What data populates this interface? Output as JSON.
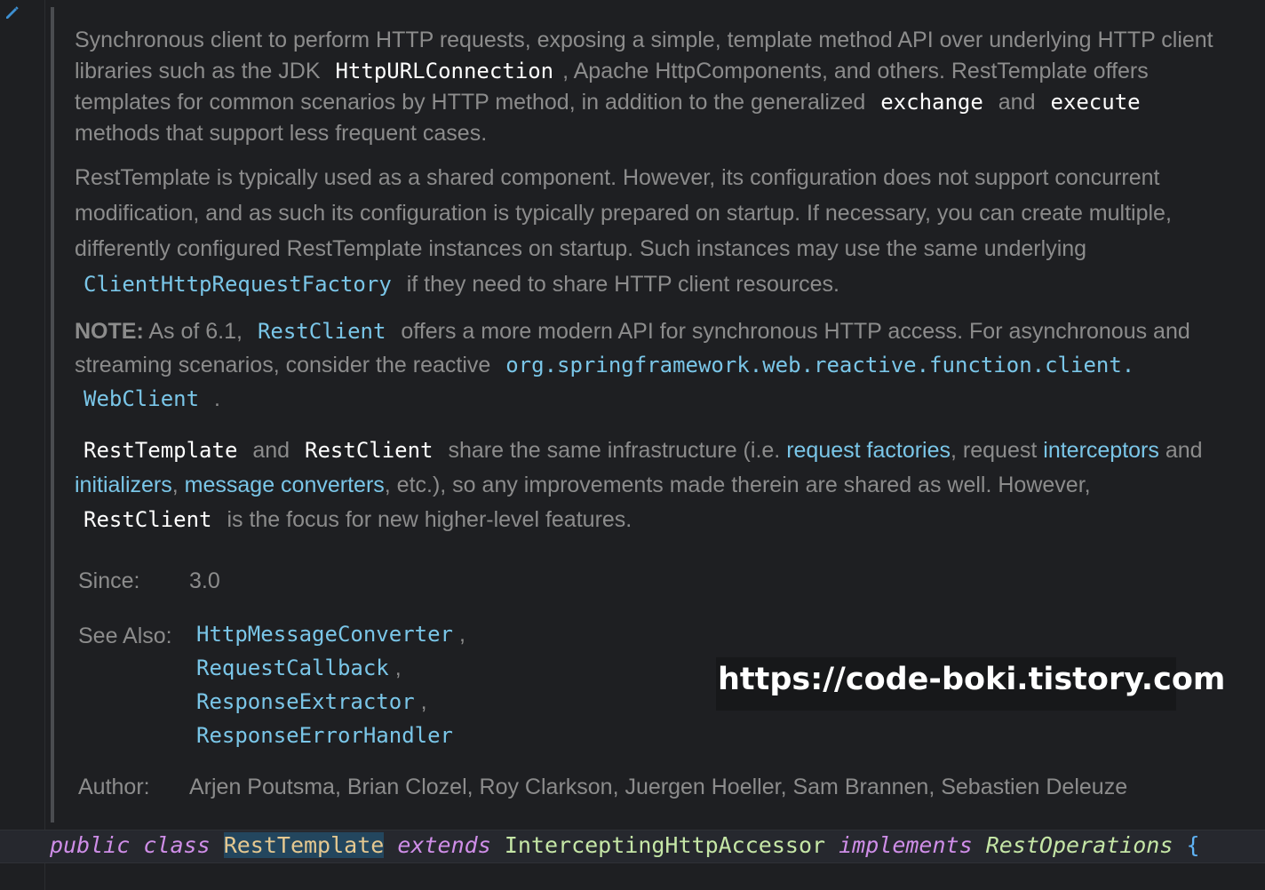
{
  "doc": {
    "p1": {
      "t1": "Synchronous client to perform HTTP requests, exposing a simple, template method API over underlying HTTP client libraries such as the JDK",
      "c1": "HttpURLConnection",
      "t2": ", Apache HttpComponents, and others. RestTemplate offers templates for common scenarios by HTTP method, in addition to the generalized",
      "c2": "exchange",
      "t3": "and",
      "c3": "execute",
      "t4": "methods that support less frequent cases."
    },
    "p2": {
      "t1": "RestTemplate is typically used as a shared component. However, its configuration does not support concurrent modification, and as such its configuration is typically prepared on startup. If necessary, you can create multiple, differently configured RestTemplate instances on startup. Such instances may use the same underlying",
      "c1": "ClientHttpRequestFactory",
      "t2": "if they need to share HTTP client resources."
    },
    "p3": {
      "note": "NOTE:",
      "t1": "As of 6.1,",
      "c1": "RestClient",
      "t2": "offers a more modern API for synchronous HTTP access. For asynchronous and streaming scenarios, consider the reactive",
      "c2": "org.springframework.web.reactive.function.client.",
      "c3": "WebClient",
      "t3": "."
    },
    "p4": {
      "c1": "RestTemplate",
      "t1": "and",
      "c2": "RestClient",
      "t2": "share the same infrastructure (i.e.",
      "l1": "request factories",
      "t3": ", request",
      "l2": "interceptors",
      "t4": "and",
      "l3": "initializers",
      "t5": ",",
      "l4": "message converters",
      "t6": ", etc.), so any improvements made therein are shared as well. However,",
      "c3": "RestClient",
      "t7": "is the focus for new higher-level features."
    }
  },
  "tags": {
    "since_label": "Since:",
    "since_value": "3.0",
    "see_also_label": "See Also:",
    "see_also": [
      "HttpMessageConverter",
      "RequestCallback",
      "ResponseExtractor",
      "ResponseErrorHandler"
    ],
    "comma": ",",
    "author_label": "Author:",
    "author_value": "Arjen Poutsma, Brian Clozel, Roy Clarkson, Juergen Hoeller, Sam Brannen, Sebastien Deleuze"
  },
  "watermark": "https://code-boki.tistory.com",
  "code": {
    "kw_public": "public",
    "kw_class": "class",
    "class_name": "RestTemplate",
    "kw_extends": "extends",
    "super_class": "InterceptingHttpAccessor",
    "kw_implements": "implements",
    "interface": "RestOperations",
    "brace": "{"
  },
  "icons": {
    "gutter_icon": "pencil-edit-icon"
  },
  "colors": {
    "background": "#1e1f22",
    "doc_text": "#8c8c8c",
    "link": "#7ac6e8",
    "code_white": "#ffffff",
    "keyword": "#cf8ee8",
    "type": "#c5e6a6",
    "highlight": "#23465e"
  }
}
